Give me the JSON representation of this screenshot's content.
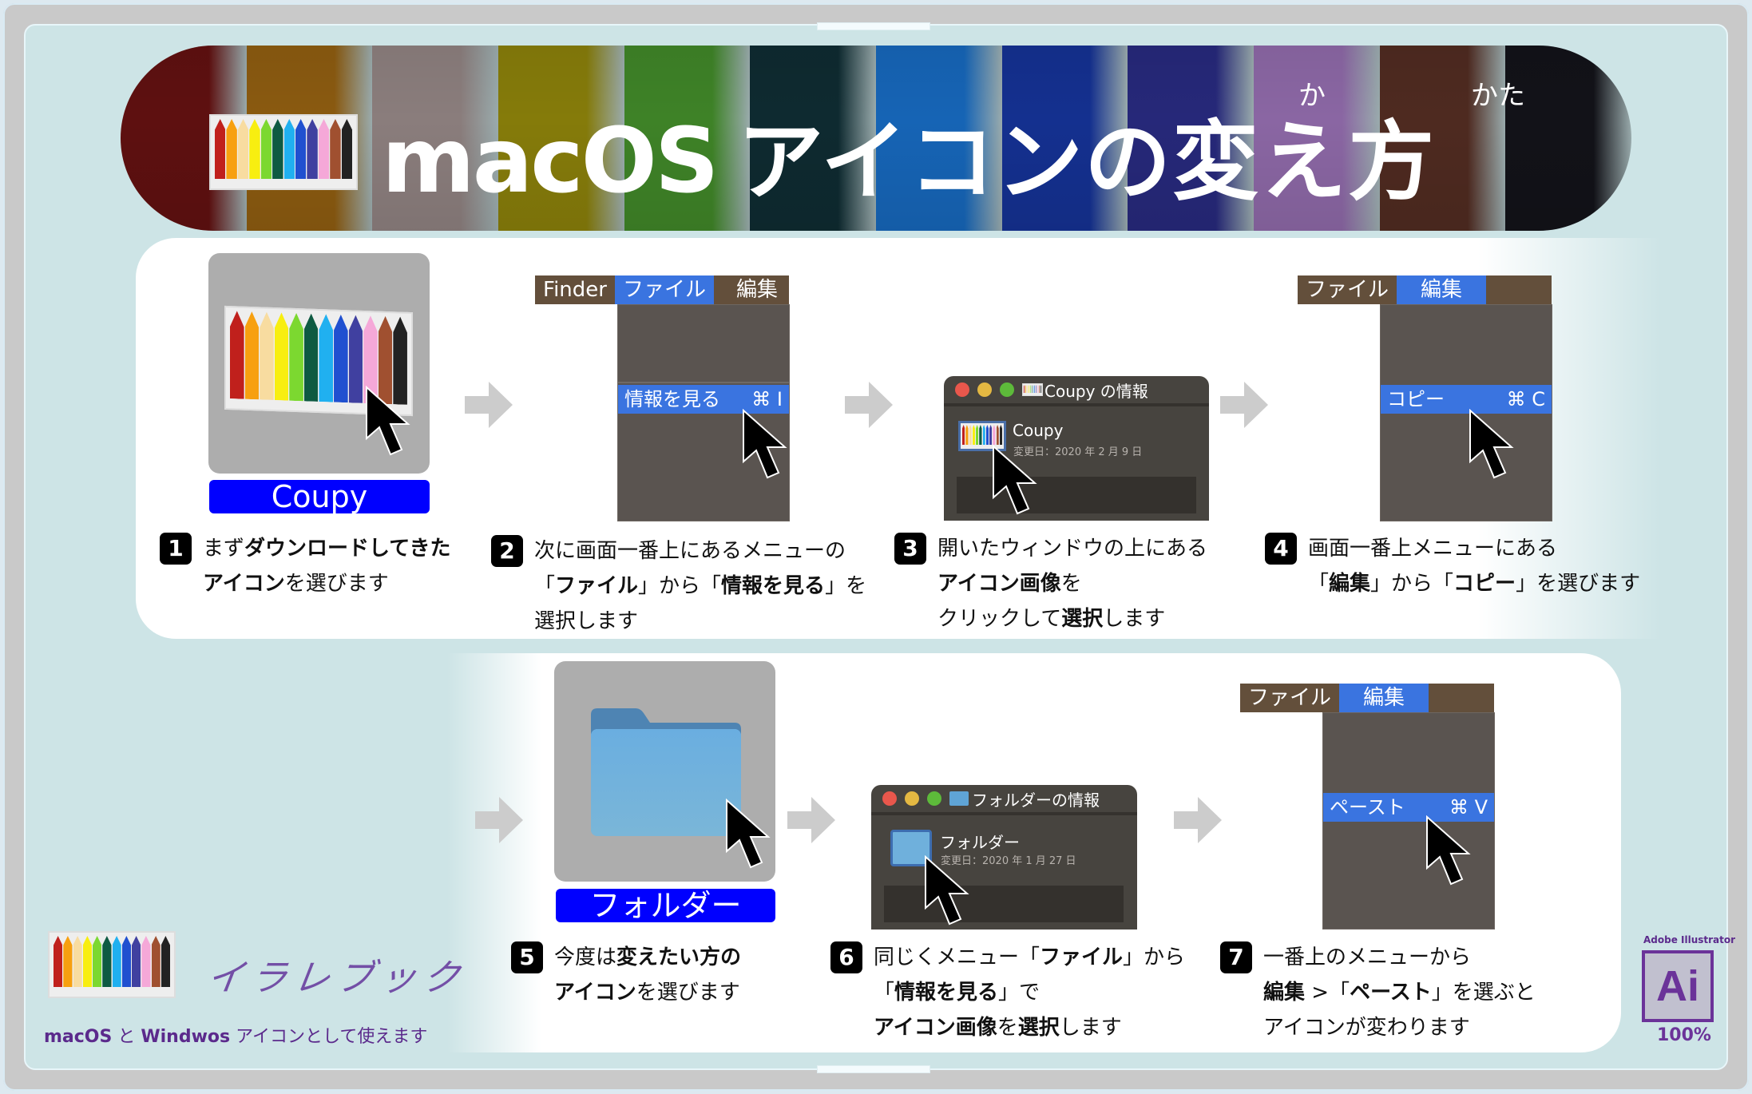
{
  "header": {
    "title_latin": "macOS",
    "title_ja": "アイコンの変え方",
    "ruby_ka": "か",
    "ruby_kata": "かた",
    "banner_colors": [
      "#5e1010",
      "#8a5a10",
      "#8a7d7c",
      "#857b0a",
      "#3e8227",
      "#0e2a30",
      "#1664b5",
      "#14308f",
      "#262879",
      "#8a66a3",
      "#4e2a20",
      "#121218"
    ]
  },
  "crayon_colors": [
    "#c0201c",
    "#f7a010",
    "#f8dca0",
    "#f8ee10",
    "#7cd830",
    "#0e5a42",
    "#20b0f0",
    "#2050d0",
    "#4040a0",
    "#f5a8d8",
    "#a05030",
    "#222222"
  ],
  "steps": [
    {
      "number": "1",
      "icon_label": "Coupy",
      "lines": [
        [
          {
            "t": "まず",
            "b": false
          },
          {
            "t": "ダウンロードしてきた",
            "b": true
          }
        ],
        [
          {
            "t": "アイコン",
            "b": true
          },
          {
            "t": "を選びます",
            "b": false
          }
        ]
      ]
    },
    {
      "number": "2",
      "menubar": [
        "Finder",
        "ファイル",
        "編集"
      ],
      "active_menu": "ファイル",
      "menu_item": "情報を見る",
      "shortcut": "⌘ I",
      "lines": [
        [
          {
            "t": "次に画面一番上にあるメニューの",
            "b": false
          }
        ],
        [
          {
            "t": "「",
            "b": false
          },
          {
            "t": "ファイル",
            "b": true
          },
          {
            "t": "」から「",
            "b": false
          },
          {
            "t": "情報を見る",
            "b": true
          },
          {
            "t": "」を",
            "b": false
          }
        ],
        [
          {
            "t": "選択します",
            "b": false
          }
        ]
      ]
    },
    {
      "number": "3",
      "window_title": "Coupy の情報",
      "file_name": "Coupy",
      "modified": "変更日：2020 年 2 月 9 日",
      "lines": [
        [
          {
            "t": "開いたウィンドウの上にある",
            "b": false
          }
        ],
        [
          {
            "t": "アイコン画像",
            "b": true
          },
          {
            "t": "を",
            "b": false
          }
        ],
        [
          {
            "t": "クリックして",
            "b": false
          },
          {
            "t": "選択",
            "b": true
          },
          {
            "t": "します",
            "b": false
          }
        ]
      ]
    },
    {
      "number": "4",
      "menubar": [
        "ファイル",
        "編集"
      ],
      "active_menu": "編集",
      "menu_item": "コピー",
      "shortcut": "⌘ C",
      "lines": [
        [
          {
            "t": "画面一番上メニューにある",
            "b": false
          }
        ],
        [
          {
            "t": "「",
            "b": false
          },
          {
            "t": "編集",
            "b": true
          },
          {
            "t": "」から「",
            "b": false
          },
          {
            "t": "コピー",
            "b": true
          },
          {
            "t": "」を選びます",
            "b": false
          }
        ]
      ]
    },
    {
      "number": "5",
      "icon_label": "フォルダー",
      "lines": [
        [
          {
            "t": "今度は",
            "b": false
          },
          {
            "t": "変えたい方の",
            "b": true
          }
        ],
        [
          {
            "t": "アイコン",
            "b": true
          },
          {
            "t": "を選びます",
            "b": false
          }
        ]
      ]
    },
    {
      "number": "6",
      "window_title": "フォルダーの情報",
      "file_name": "フォルダー",
      "modified": "変更日：2020 年 1 月 27 日",
      "lines": [
        [
          {
            "t": "同じくメニュー「",
            "b": false
          },
          {
            "t": "ファイル",
            "b": true
          },
          {
            "t": "」から",
            "b": false
          }
        ],
        [
          {
            "t": "「",
            "b": false
          },
          {
            "t": "情報を見る",
            "b": true
          },
          {
            "t": "」で",
            "b": false
          }
        ],
        [
          {
            "t": "アイコン画像",
            "b": true
          },
          {
            "t": "を",
            "b": false
          },
          {
            "t": "選択",
            "b": true
          },
          {
            "t": "します",
            "b": false
          }
        ]
      ]
    },
    {
      "number": "7",
      "menubar": [
        "ファイル",
        "編集"
      ],
      "active_menu": "編集",
      "menu_item": "ペースト",
      "shortcut": "⌘ V",
      "lines": [
        [
          {
            "t": "一番上のメニューから",
            "b": false
          }
        ],
        [
          {
            "t": "編集",
            "b": true
          },
          {
            "t": " >「",
            "b": false
          },
          {
            "t": "ペースト",
            "b": true
          },
          {
            "t": "」を選ぶと",
            "b": false
          }
        ],
        [
          {
            "t": "アイコンが変わります",
            "b": false
          }
        ]
      ]
    }
  ],
  "footer": {
    "brand_name": "イラレブック",
    "tagline_macos": "macOS",
    "tagline_and": " と ",
    "tagline_windows": "Windwos",
    "tagline_rest": " アイコンとして使えます",
    "ai_caption": "Adobe Illustrator",
    "ai_label": "Ai",
    "zoom": "100%"
  },
  "colors": {
    "menu_active": "#3a74e0",
    "menubar": "#634f3b",
    "label_blue": "#0000ff",
    "brand_purple": "#5b2a8c"
  }
}
